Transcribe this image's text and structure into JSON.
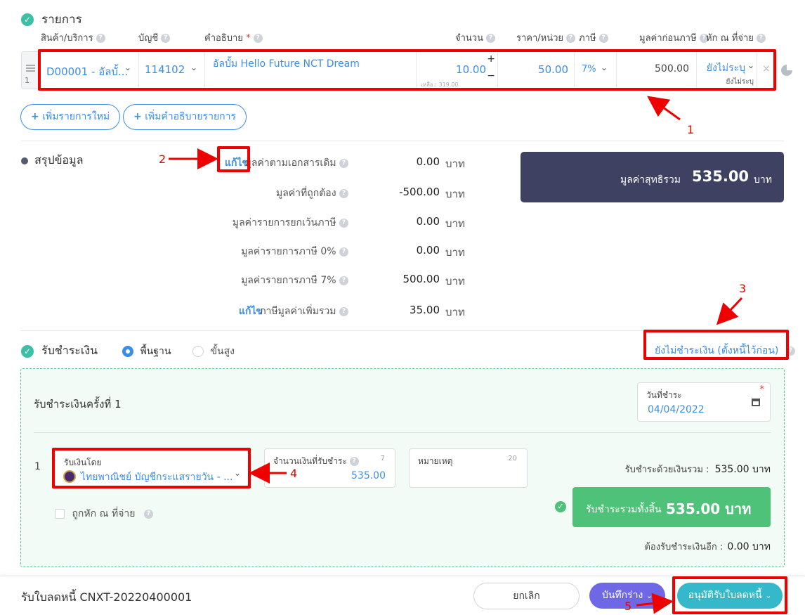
{
  "items_section": {
    "title": "รายการ",
    "headers": {
      "product": "สินค้า/บริการ",
      "account": "บัญชี",
      "description": "คำอธิบาย",
      "required_mark": "*",
      "quantity": "จำนวน",
      "price": "ราคา/หน่วย",
      "tax": "ภาษี",
      "pretax": "มูลค่าก่อนภาษี",
      "withholding": "หัก ณ ที่จ่าย"
    },
    "row": {
      "index": "1",
      "product": "D00001 - อัลบั้...",
      "account": "114102",
      "description": "อัลบั้ม Hello Future NCT Dream",
      "quantity": "10.00",
      "remaining": "เหลือ : 319.00",
      "price": "50.00",
      "tax": "7%",
      "pretax": "500.00",
      "withholding": "ยังไม่ระบุ",
      "withholding_sub": "ยังไม่ระบุ"
    },
    "add_item_label": "เพิ่มรายการใหม่",
    "add_desc_label": "เพิ่มคำอธิบายรายการ"
  },
  "summary": {
    "title": "สรุปข้อมูล",
    "edit_label": "แก้ไข",
    "rows": [
      {
        "label": "มูลค่าตามเอกสารเดิม",
        "value": "0.00",
        "unit": "บาท"
      },
      {
        "label": "มูลค่าที่ถูกต้อง",
        "value": "-500.00",
        "unit": "บาท"
      },
      {
        "label": "มูลค่ารายการยกเว้นภาษี",
        "value": "0.00",
        "unit": "บาท"
      },
      {
        "label": "มูลค่ารายการภาษี 0%",
        "value": "0.00",
        "unit": "บาท"
      },
      {
        "label": "มูลค่ารายการภาษี 7%",
        "value": "500.00",
        "unit": "บาท"
      },
      {
        "label": "ภาษีมูลค่าเพิ่มรวม",
        "value": "35.00",
        "unit": "บาท"
      }
    ],
    "net_label": "มูลค่าสุทธิรวม",
    "net_value": "535.00",
    "net_unit": "บาท"
  },
  "payment": {
    "title": "รับชำระเงิน",
    "mode_basic": "พื้นฐาน",
    "mode_advanced": "ขั้นสูง",
    "unpaid_link": "ยังไม่ชำระเงิน (ตั้งหนี้ไว้ก่อน)",
    "installment_title": "รับชำระเงินครั้งที่ 1",
    "date_label": "วันที่ชำระ",
    "date_value": "04/04/2022",
    "row_index": "1",
    "method_label": "รับเงินโดย",
    "method_value": "ไทยพาณิชย์ บัญชีกระแสรายวัน - ...",
    "amount_label": "จำนวนเงินที่รับชำระ",
    "amount_count": "7",
    "amount_value": "535.00",
    "note_label": "หมายเหตุ",
    "note_count": "20",
    "withheld_label": "ถูกหัก ณ ที่จ่าย",
    "total_paid_label": "รับชำระด้วยเงินรวม :",
    "total_paid_value": "535.00 บาท",
    "grand_label": "รับชำระรวมทั้งสิ้น",
    "grand_value": "535.00 บาท",
    "remaining_label": "ต้องรับชำระเงินอีก :",
    "remaining_value": "0.00 บาท"
  },
  "footer": {
    "doc_title": "รับใบลดหนี้ CNXT-20220400001",
    "cancel_label": "ยกเลิก",
    "draft_label": "บันทึกร่าง",
    "approve_label": "อนุมัติรับใบลดหนี้"
  },
  "annotations": [
    "1",
    "2",
    "3",
    "4",
    "5"
  ],
  "colors": {
    "accent": "#3a8ee6",
    "teal": "#3bbfa6",
    "net_panel": "#3f4162",
    "success": "#4fc27a",
    "annotation": "#ee0000"
  }
}
